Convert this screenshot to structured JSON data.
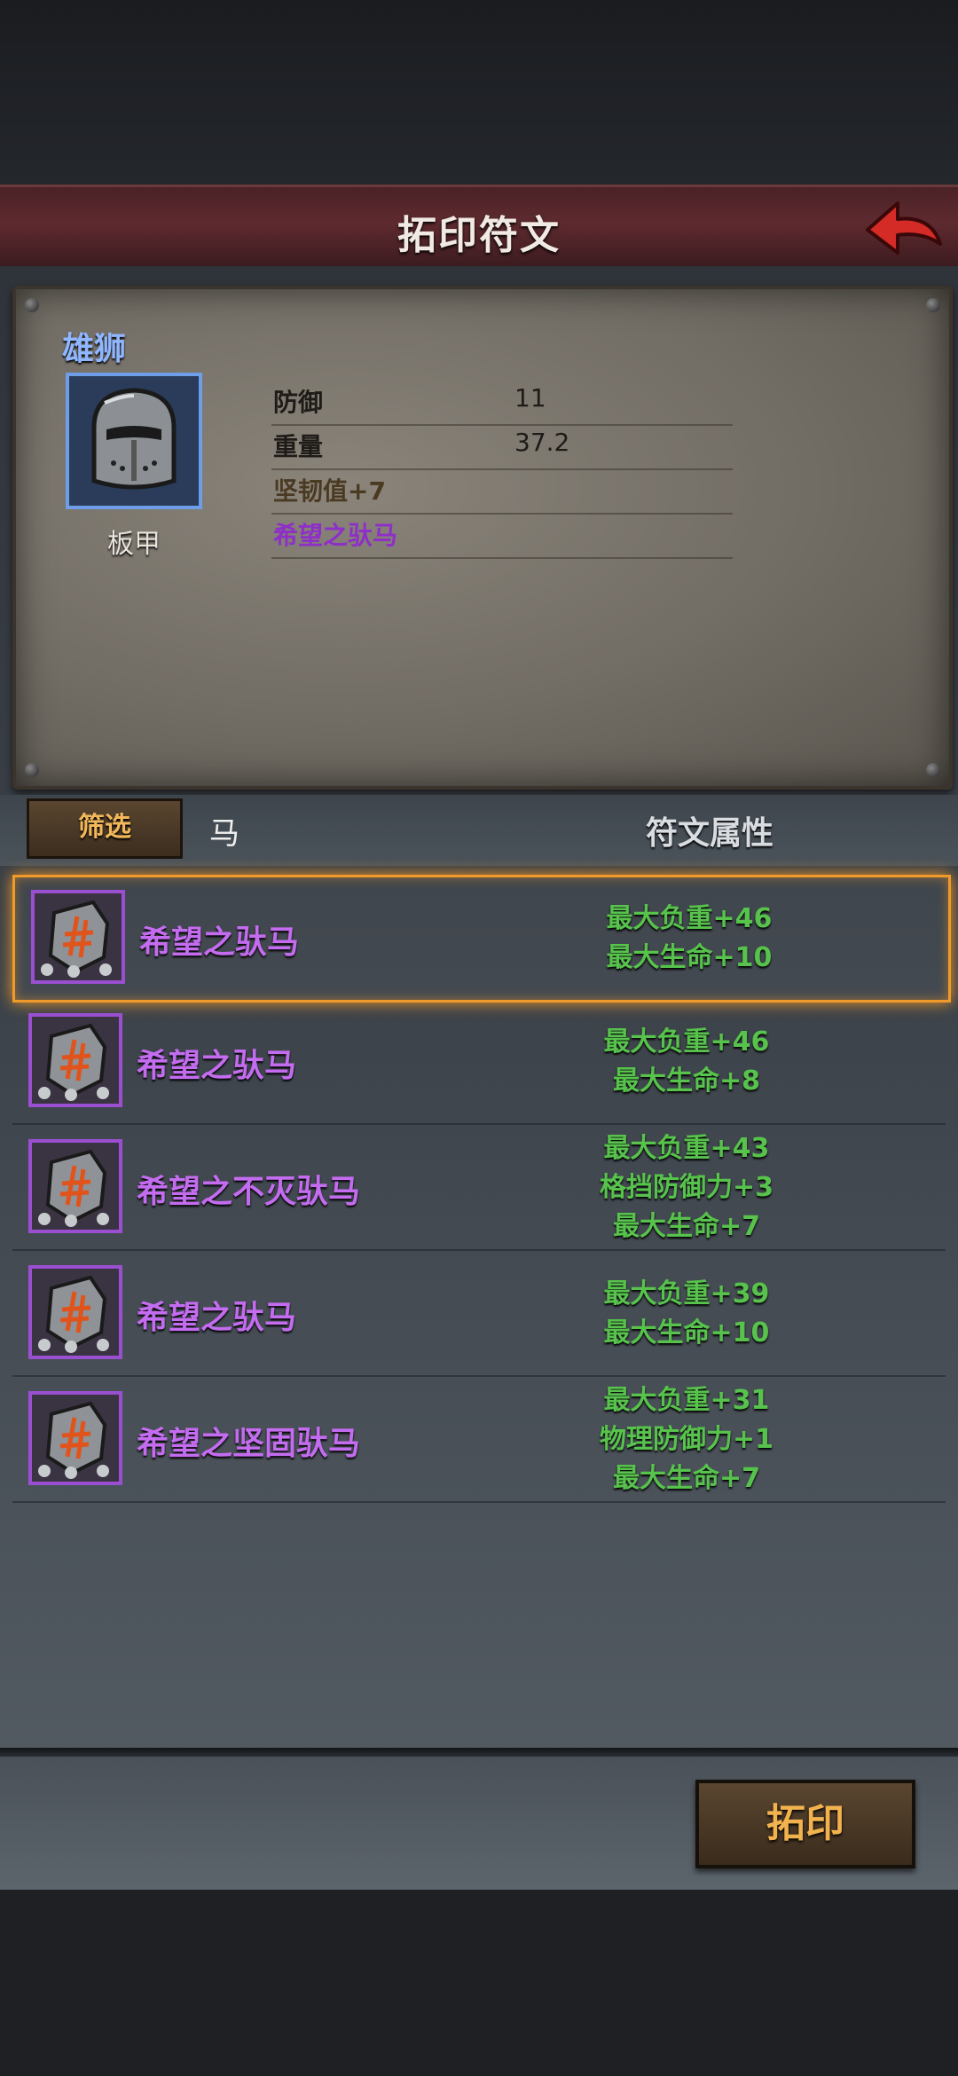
{
  "header": {
    "title": "拓印符文"
  },
  "equipment": {
    "name": "雄狮",
    "type": "板甲",
    "icon": "knight-helmet-icon",
    "stats": [
      {
        "label": "防御",
        "value": "11"
      },
      {
        "label": "重量",
        "value": "37.2"
      }
    ],
    "bonus": "坚韧值+7",
    "rune": "希望之驮马"
  },
  "filter": {
    "button_label": "筛选",
    "value": "马",
    "column_header": "符文属性"
  },
  "runes": [
    {
      "name": "希望之驮马",
      "attrs": [
        "最大负重+46",
        "最大生命+10"
      ],
      "selected": true
    },
    {
      "name": "希望之驮马",
      "attrs": [
        "最大负重+46",
        "最大生命+8"
      ]
    },
    {
      "name": "希望之不灭驮马",
      "attrs": [
        "最大负重+43",
        "格挡防御力+3",
        "最大生命+7"
      ]
    },
    {
      "name": "希望之驮马",
      "attrs": [
        "最大负重+39",
        "最大生命+10"
      ]
    },
    {
      "name": "希望之坚固驮马",
      "attrs": [
        "最大负重+31",
        "物理防御力+1",
        "最大生命+7"
      ]
    }
  ],
  "actions": {
    "primary_label": "拓印"
  },
  "colors": {
    "rune_name": "#c46cf0",
    "attr": "#57c24c",
    "equip_name": "#8fb6ff",
    "bonus": "#8a5a1e",
    "rune_text": "#a03fd8",
    "highlight": "#f09a2a"
  }
}
